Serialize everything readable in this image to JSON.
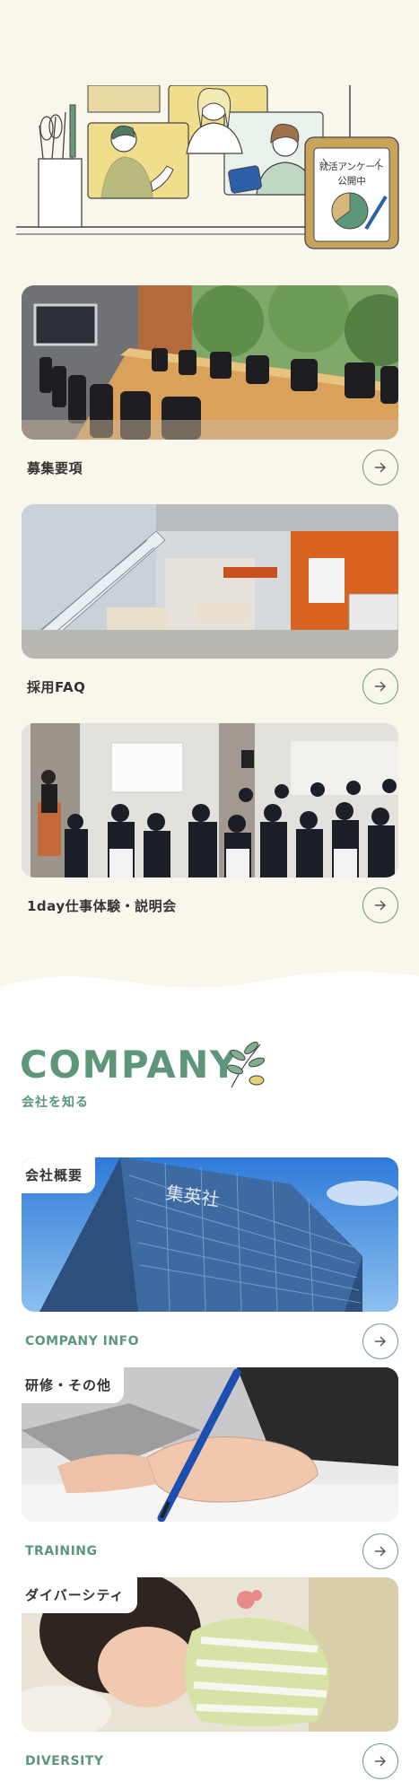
{
  "illustration": {
    "survey_sign": [
      "就活アンケート",
      "公開中"
    ]
  },
  "recruit_links": [
    {
      "label": "募集要項"
    },
    {
      "label": "採用FAQ"
    },
    {
      "label": "1day仕事体験・説明会"
    }
  ],
  "company": {
    "title": "COMPANY",
    "subtitle": "会社を知る",
    "building_sign": "集英社",
    "items": [
      {
        "tag": "会社概要",
        "label": "COMPANY INFO"
      },
      {
        "tag": "研修・その他",
        "label": "TRAINING"
      },
      {
        "tag": "ダイバーシティ",
        "label": "DIVERSITY"
      }
    ]
  },
  "colors": {
    "accent_green": "#5e9679",
    "background_cream": "#f9f6ec",
    "illustration_yellow": "#f1de8c"
  },
  "icons": [
    "arrow-right-icon",
    "leaf-icon"
  ]
}
